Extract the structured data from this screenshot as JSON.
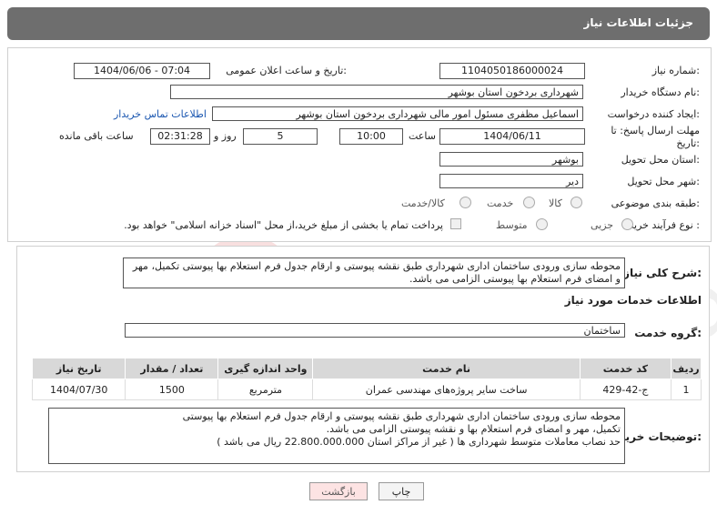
{
  "header": {
    "title": "جزئیات اطلاعات نیاز"
  },
  "need": {
    "number_label": "شماره نیاز:",
    "number": "1104050186000024",
    "announce_label": "تاریخ و ساعت اعلان عمومی:",
    "announce_value": "1404/06/06 - 07:04",
    "buyer_org_label": "نام دستگاه خریدار:",
    "buyer_org": "شهرداری بردخون استان بوشهر",
    "creator_label": "ایجاد کننده درخواست:",
    "creator": "اسماعیل مظفری مسئول امور مالی شهرداری بردخون استان بوشهر",
    "contact_link": "اطلاعات تماس خریدار",
    "deadline_label": "مهلت ارسال پاسخ: تا تاریخ:",
    "deadline_date": "1404/06/11",
    "time_label": "ساعت",
    "deadline_time": "10:00",
    "days_value": "5",
    "days_label": "روز و",
    "remaining_time": "02:31:28",
    "remaining_label": "ساعت باقی مانده",
    "province_label": "استان محل تحویل:",
    "province": "بوشهر",
    "city_label": "شهر محل تحویل:",
    "city": "دیر",
    "category_label": "طبقه بندی موضوعی:",
    "category_options": [
      "کالا",
      "خدمت",
      "کالا/خدمت"
    ],
    "process_label": "نوع فرآیند خرید :",
    "process_options": [
      "جزیی",
      "متوسط"
    ],
    "payment_note": "پرداخت تمام یا بخشی از مبلغ خرید،از محل \"اسناد خزانه اسلامی\" خواهد بود."
  },
  "summary": {
    "label": "شرح کلی نیاز:",
    "text": "محوطه سازی ورودی ساختمان اداری شهرداری طبق نقشه پیوستی و ارقام جدول فرم استعلام بها پیوستی تکمیل، مهر و امضای فرم استعلام بها پیوستی الزامی می باشد."
  },
  "services": {
    "section_title": "اطلاعات خدمات مورد نیاز",
    "group_label": "گروه خدمت:",
    "group_value": "ساختمان",
    "columns": [
      "ردیف",
      "کد خدمت",
      "نام خدمت",
      "واحد اندازه گیری",
      "تعداد / مقدار",
      "تاریخ نیاز"
    ],
    "rows": [
      {
        "row": "1",
        "code": "ج-42-429",
        "name": "ساخت سایر پروژه‌های مهندسی عمران",
        "unit": "مترمربع",
        "qty": "1500",
        "date": "1404/07/30"
      }
    ]
  },
  "buyer_notes": {
    "label": "توضیحات خریدار:",
    "line1": "محوطه سازی ورودی ساختمان اداری شهرداری طبق نقشه پیوستی و ارقام جدول فرم استعلام بها پیوستی",
    "line2": "تکمیل، مهر و امضای فرم استعلام بها و نقشه پیوستی الزامی می باشد.",
    "line3": "حد نصاب معاملات متوسط شهرداری ها ( غیر از مراکز استان 22.800.000.000 ریال می باشد )"
  },
  "buttons": {
    "print": "چاپ",
    "back": "بازگشت"
  },
  "watermark": {
    "text": "AriaTender.neT"
  }
}
